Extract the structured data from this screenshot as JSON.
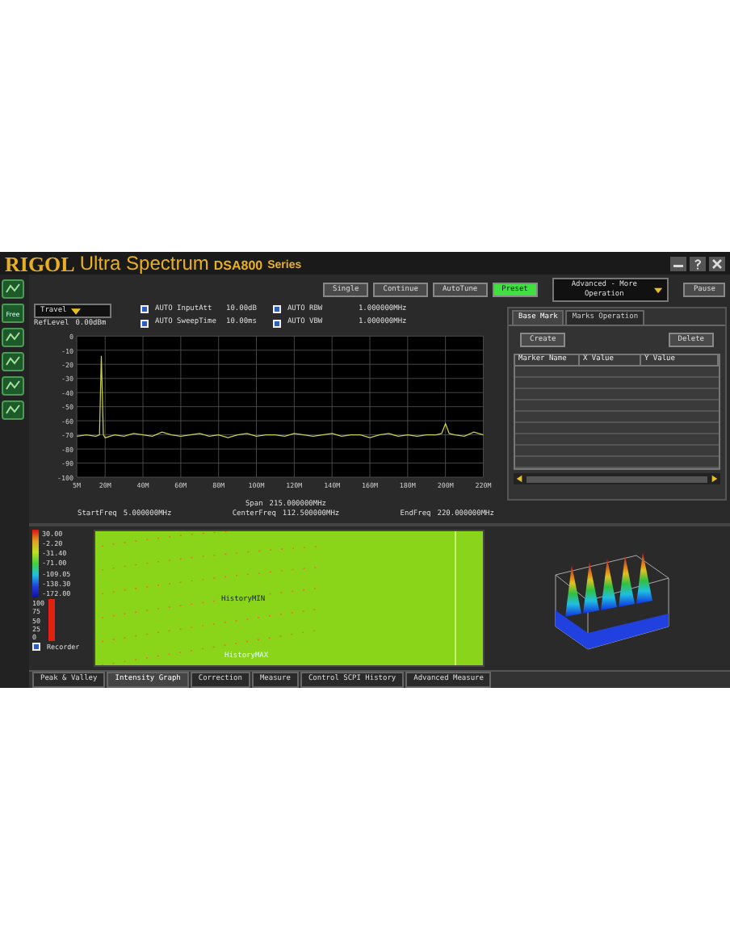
{
  "window": {
    "brand": "RIGOL",
    "title": "Ultra Spectrum",
    "model": "DSA800",
    "series": "Series"
  },
  "sidebar": {
    "buttons": [
      {
        "kind": "icon"
      },
      {
        "kind": "text",
        "label": "Free"
      },
      {
        "kind": "icon"
      },
      {
        "kind": "icon"
      },
      {
        "kind": "icon"
      },
      {
        "kind": "icon"
      }
    ]
  },
  "toolbar": {
    "buttons": [
      {
        "label": "Single",
        "active": false
      },
      {
        "label": "Continue",
        "active": false
      },
      {
        "label": "AutoTune",
        "active": false
      },
      {
        "label": "Preset",
        "active": true
      }
    ],
    "mode_dropdown": "Advanced - More Operation",
    "pause_button": "Pause"
  },
  "settings": {
    "trace_mode": "Travel",
    "ref_level_label": "RefLevel",
    "ref_level": "0.00dBm",
    "auto": [
      {
        "label": "AUTO InputAtt",
        "value": "10.00dB",
        "checked": true
      },
      {
        "label": "AUTO SweepTime",
        "value": "10.00ms",
        "checked": true
      },
      {
        "label": "AUTO RBW",
        "value": "1.000000MHz",
        "checked": true
      },
      {
        "label": "AUTO VBW",
        "value": "1.000000MHz",
        "checked": true
      }
    ]
  },
  "spectrum": {
    "chart_data": {
      "type": "line",
      "x": [
        5,
        10,
        15,
        17,
        18,
        19,
        20,
        25,
        30,
        35,
        40,
        45,
        50,
        55,
        60,
        65,
        70,
        75,
        80,
        85,
        90,
        95,
        100,
        105,
        110,
        115,
        120,
        125,
        130,
        135,
        140,
        145,
        150,
        155,
        160,
        165,
        170,
        175,
        180,
        185,
        190,
        195,
        198,
        200,
        202,
        205,
        210,
        215,
        220
      ],
      "grid": true,
      "series": [
        {
          "color": "#c8d048",
          "values": [
            -71,
            -70,
            -71,
            -70,
            -14,
            -70,
            -72,
            -70,
            -71,
            -69,
            -70,
            -71,
            -68,
            -70,
            -71,
            -70,
            -69,
            -71,
            -70,
            -72,
            -70,
            -69,
            -71,
            -70,
            -70,
            -71,
            -69,
            -70,
            -71,
            -70,
            -69,
            -71,
            -70,
            -70,
            -72,
            -70,
            -69,
            -71,
            -70,
            -71,
            -70,
            -70,
            -69,
            -62,
            -69,
            -70,
            -71,
            -68,
            -70
          ]
        }
      ],
      "xlim": [
        5,
        220
      ],
      "ylim": [
        -100,
        0
      ],
      "yticks": [
        {
          "value": 0,
          "label": "0"
        },
        {
          "value": -10,
          "label": "-10"
        },
        {
          "value": -20,
          "label": "-20"
        },
        {
          "value": -30,
          "label": "-30"
        },
        {
          "value": -40,
          "label": "-40"
        },
        {
          "value": -50,
          "label": "-50"
        },
        {
          "value": -60,
          "label": "-60"
        },
        {
          "value": -70,
          "label": "-70"
        },
        {
          "value": -80,
          "label": "-80"
        },
        {
          "value": -90,
          "label": "-90"
        },
        {
          "value": -100,
          "label": "-100"
        }
      ],
      "xticks": [
        {
          "value": 5,
          "label": "5M"
        },
        {
          "value": 20,
          "label": "20M"
        },
        {
          "value": 40,
          "label": "40M"
        },
        {
          "value": 60,
          "label": "60M"
        },
        {
          "value": 80,
          "label": "80M"
        },
        {
          "value": 100,
          "label": "100M"
        },
        {
          "value": 120,
          "label": "120M"
        },
        {
          "value": 140,
          "label": "140M"
        },
        {
          "value": 160,
          "label": "160M"
        },
        {
          "value": 180,
          "label": "180M"
        },
        {
          "value": 200,
          "label": "200M"
        },
        {
          "value": 220,
          "label": "220M"
        }
      ]
    },
    "start_freq_label": "StartFreq",
    "start_freq": "5.000000MHz",
    "span_label": "Span",
    "span": "215.000000MHz",
    "center_freq_label": "CenterFreq",
    "center_freq": "112.500000MHz",
    "end_freq_label": "EndFreq",
    "end_freq": "220.000000MHz"
  },
  "marker_panel": {
    "tabs": [
      {
        "label": "Base Mark",
        "selected": true
      },
      {
        "label": "Marks Operation",
        "selected": false
      }
    ],
    "create_button": "Create",
    "delete_button": "Delete",
    "columns": [
      "Marker Name",
      "X Value",
      "Y Value"
    ]
  },
  "intensity": {
    "scale": [
      "30.00",
      "-2.20",
      "-31.40",
      "-71.00",
      "-109.05",
      "-138.30",
      "-172.00"
    ],
    "recorder_ticks": [
      "100",
      "75",
      "50",
      "25",
      "0"
    ],
    "recorder_meter": {
      "level": 1
    },
    "recorder": {
      "label": "Recorder",
      "checked": true
    },
    "min_label": "HistoryMIN",
    "max_label": "HistoryMAX"
  },
  "bottom_tabs": [
    {
      "label": "Peak & Valley",
      "selected": false
    },
    {
      "label": "Intensity Graph",
      "selected": true
    },
    {
      "label": "Correction",
      "selected": false
    },
    {
      "label": "Measure",
      "selected": false
    },
    {
      "label": "Control SCPI History",
      "selected": false
    },
    {
      "label": "Advanced Measure",
      "selected": false
    }
  ]
}
